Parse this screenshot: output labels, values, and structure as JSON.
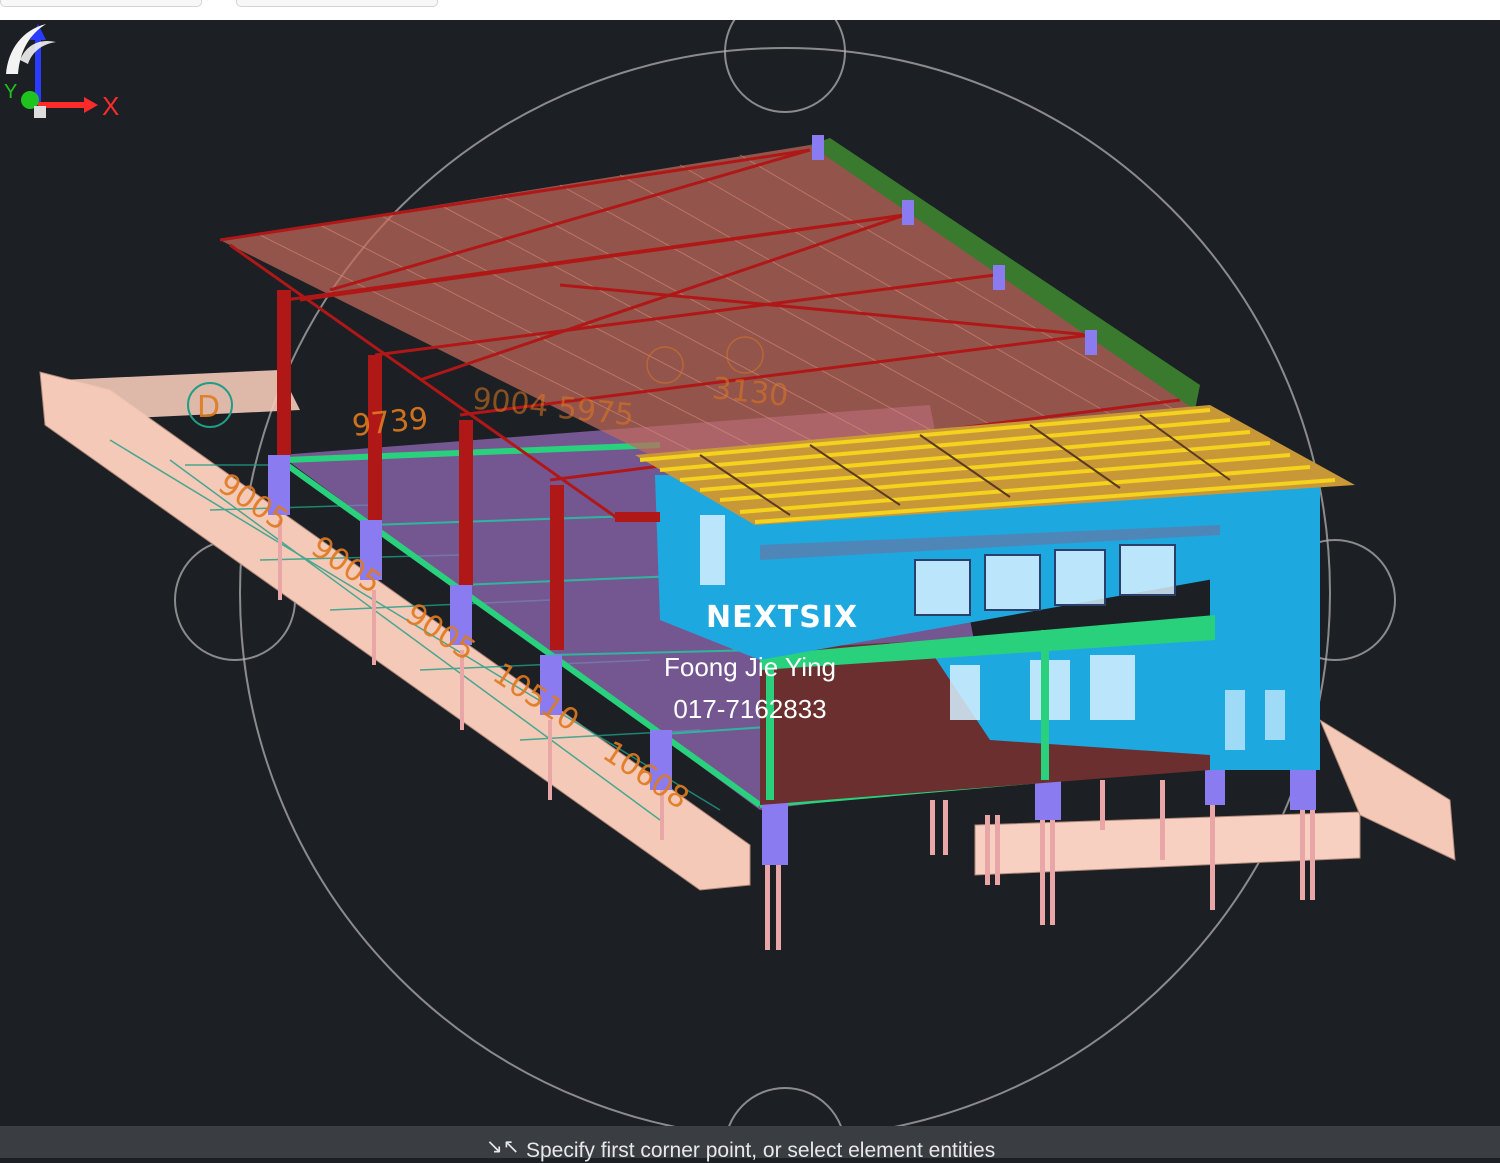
{
  "viewport": {
    "grid_label": "D",
    "dimensions": [
      {
        "text": "9739"
      },
      {
        "text": "9004 5975"
      },
      {
        "text": "3130"
      },
      {
        "text": "9005"
      },
      {
        "text": "9005"
      },
      {
        "text": "9005"
      },
      {
        "text": "10510"
      },
      {
        "text": "10608"
      }
    ],
    "ucs": {
      "x_label": "X",
      "y_label": "Y"
    }
  },
  "watermark": {
    "brand": "NEXTSIX",
    "name": "Foong Jie Ying",
    "phone": "017-7162833"
  },
  "command_line": {
    "icon": "cursor-arrows-icon",
    "prompt": "Specify first corner point, or select element entities"
  },
  "colors": {
    "background": "#1c1f24",
    "roof": "#c26a5a",
    "steel": "#b01818",
    "walls": "#1ea8e0",
    "slab": "#9a6fc0",
    "beam": "#f0c8b8"
  }
}
